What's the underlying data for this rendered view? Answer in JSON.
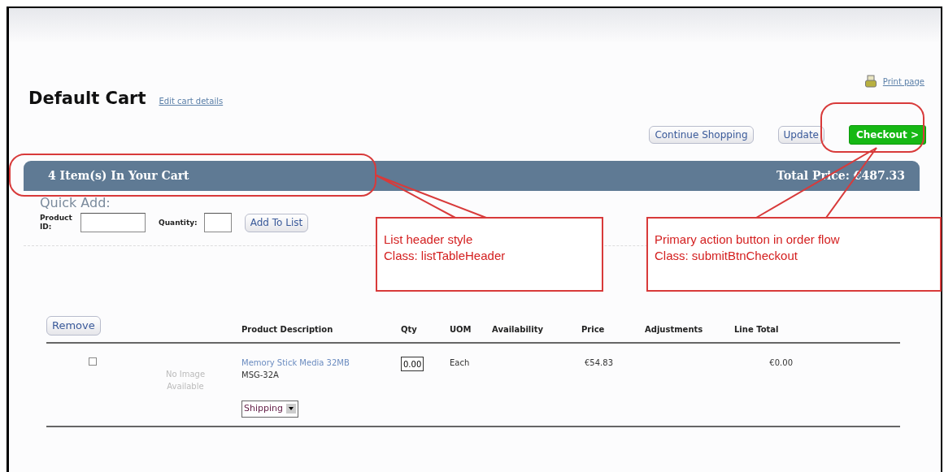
{
  "cart": {
    "title": "Default Cart",
    "edit_link": "Edit cart details",
    "print_link": "Print page"
  },
  "actions": [
    {
      "label": "Continue Shopping",
      "kind": "plain"
    },
    {
      "label": "Update",
      "kind": "plain"
    },
    {
      "label": "Checkout >",
      "kind": "primary"
    }
  ],
  "list_header": {
    "count": "4 Item(s) In Your Cart",
    "total": "Total Price: €487.33"
  },
  "quick_add": {
    "title": "Quick Add:",
    "product_label": "Product ID:",
    "quantity_label": "Quantity:",
    "button": "Add To List"
  },
  "table": {
    "remove_button": "Remove",
    "columns": [
      "Product Description",
      "Qty",
      "UOM",
      "Availability",
      "Price",
      "Adjustments",
      "Line Total"
    ],
    "rows": [
      {
        "checked": false,
        "image_text": "No Image Available",
        "product": "Memory Stick Media 32MB",
        "sku": "MSG-32A",
        "qty": "0.00",
        "uom": "Each",
        "price": "€54.83",
        "line_total": "€0.00",
        "delivery": "Shipping"
      }
    ]
  },
  "annotations": [
    {
      "lines": [
        "List header style",
        "Class: listTableHeader"
      ]
    },
    {
      "lines": [
        "Primary action button in order flow",
        "Class: submitBtnCheckout"
      ]
    }
  ]
}
